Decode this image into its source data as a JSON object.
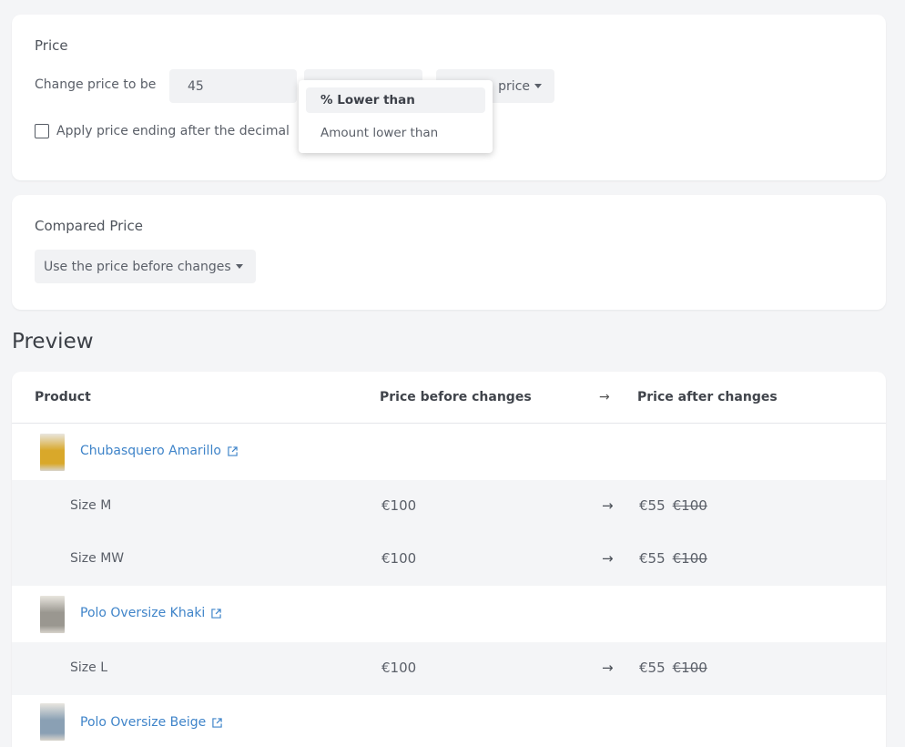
{
  "price_section": {
    "title": "Price",
    "change_label": "Change price to be",
    "amount_value": "45",
    "base_select_label": "price",
    "apply_ending_label": "Apply price ending after the decimal",
    "dropdown_options": [
      "% Lower than",
      "Amount lower than"
    ]
  },
  "compared_section": {
    "title": "Compared Price",
    "select_label": "Use the price before changes"
  },
  "preview": {
    "title": "Preview",
    "columns": {
      "product": "Product",
      "before": "Price before changes",
      "arrow": "→",
      "after": "Price after changes"
    },
    "products": [
      {
        "name": "Chubasquero Amarillo",
        "thumb_color": "#d9a82a",
        "variants": [
          {
            "name": "Size M",
            "before": "€100",
            "after": "€55",
            "compare": "€100"
          },
          {
            "name": "Size MW",
            "before": "€100",
            "after": "€55",
            "compare": "€100"
          }
        ]
      },
      {
        "name": "Polo Oversize Khaki",
        "thumb_color": "#9a9790",
        "variants": [
          {
            "name": "Size L",
            "before": "€100",
            "after": "€55",
            "compare": "€100"
          }
        ]
      },
      {
        "name": "Polo Oversize Beige",
        "thumb_color": "#8aa0b4",
        "variants": []
      }
    ]
  },
  "colors": {
    "link": "#3f84c9",
    "background": "#f4f5f7"
  }
}
